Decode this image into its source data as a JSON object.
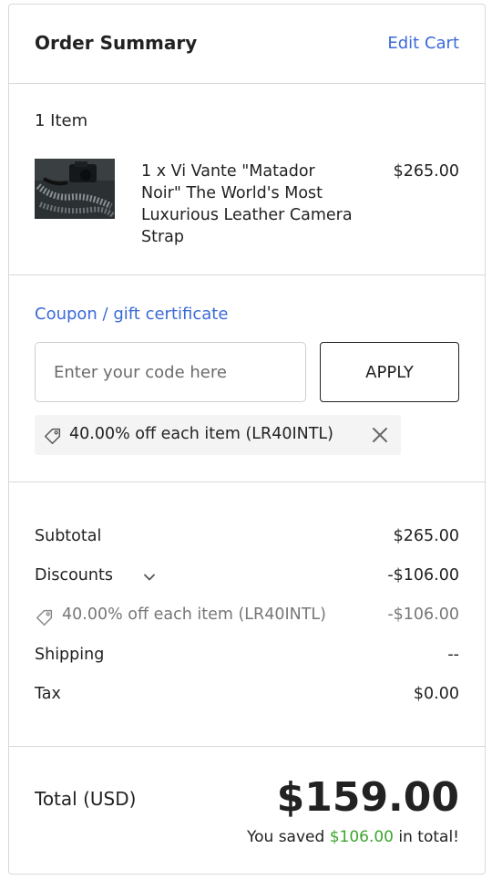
{
  "header": {
    "title": "Order Summary",
    "edit_label": "Edit Cart"
  },
  "items": {
    "count_label": "1 Item",
    "list": [
      {
        "name": "1 x Vi Vante \"Matador Noir\" The World's Most Luxurious Leather Camera Strap",
        "price": "$265.00"
      }
    ]
  },
  "coupon": {
    "link_label": "Coupon / gift certificate",
    "input_placeholder": "Enter your code here",
    "input_value": "",
    "apply_label": "APPLY",
    "applied": {
      "text": "40.00% off each item (LR40INTL)",
      "icon": "tag-icon",
      "remove_icon": "close-icon"
    }
  },
  "totals": {
    "subtotal": {
      "label": "Subtotal",
      "value": "$265.00"
    },
    "discounts": {
      "label": "Discounts",
      "value": "-$106.00",
      "icon": "chevron-down-icon"
    },
    "discount_detail": {
      "label": "40.00% off each item (LR40INTL)",
      "value": "-$106.00",
      "icon": "tag-icon"
    },
    "shipping": {
      "label": "Shipping",
      "value": "--"
    },
    "tax": {
      "label": "Tax",
      "value": "$0.00"
    }
  },
  "grand_total": {
    "label": "Total (USD)",
    "amount": "$159.00",
    "saved_prefix": "You saved",
    "saved_amount": "$106.00",
    "saved_suffix": "in total!"
  },
  "colors": {
    "link": "#3b6ad8",
    "savings": "#3da52f",
    "border": "#d9d9d9",
    "chip_bg": "#f4f4f4"
  }
}
